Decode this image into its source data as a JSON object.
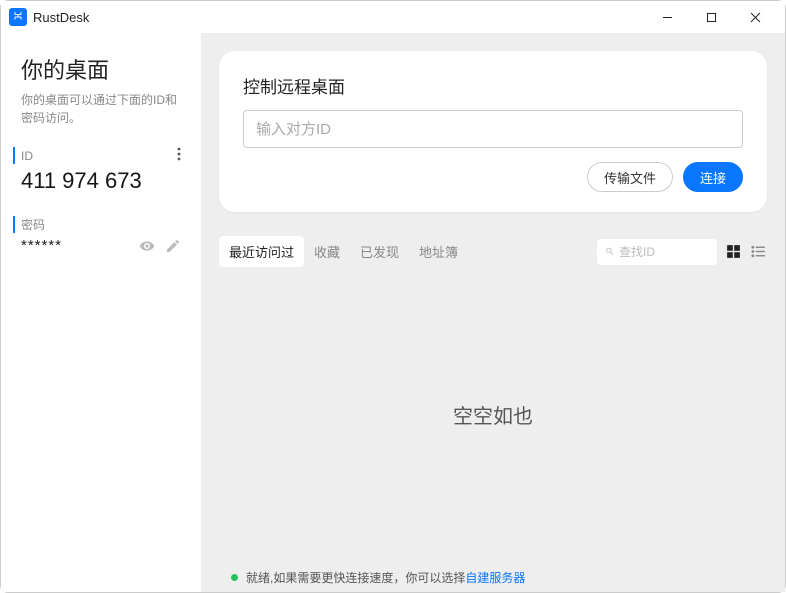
{
  "app": {
    "title": "RustDesk"
  },
  "sidebar": {
    "title": "你的桌面",
    "subtitle": "你的桌面可以通过下面的ID和密码访问。",
    "id_label": "ID",
    "id_value": "411 974 673",
    "pwd_label": "密码",
    "pwd_value": "******"
  },
  "remote": {
    "title": "控制远程桌面",
    "placeholder": "输入对方ID",
    "file_btn": "传输文件",
    "connect_btn": "连接"
  },
  "tabs": {
    "recent": "最近访问过",
    "fav": "收藏",
    "discovered": "已发现",
    "addressbook": "地址簿"
  },
  "search": {
    "placeholder": "查找ID"
  },
  "empty": "空空如也",
  "status": {
    "ready": "就绪, ",
    "hint_prefix": "如果需要更快连接速度，你可以选择",
    "hint_link": "自建服务器"
  }
}
